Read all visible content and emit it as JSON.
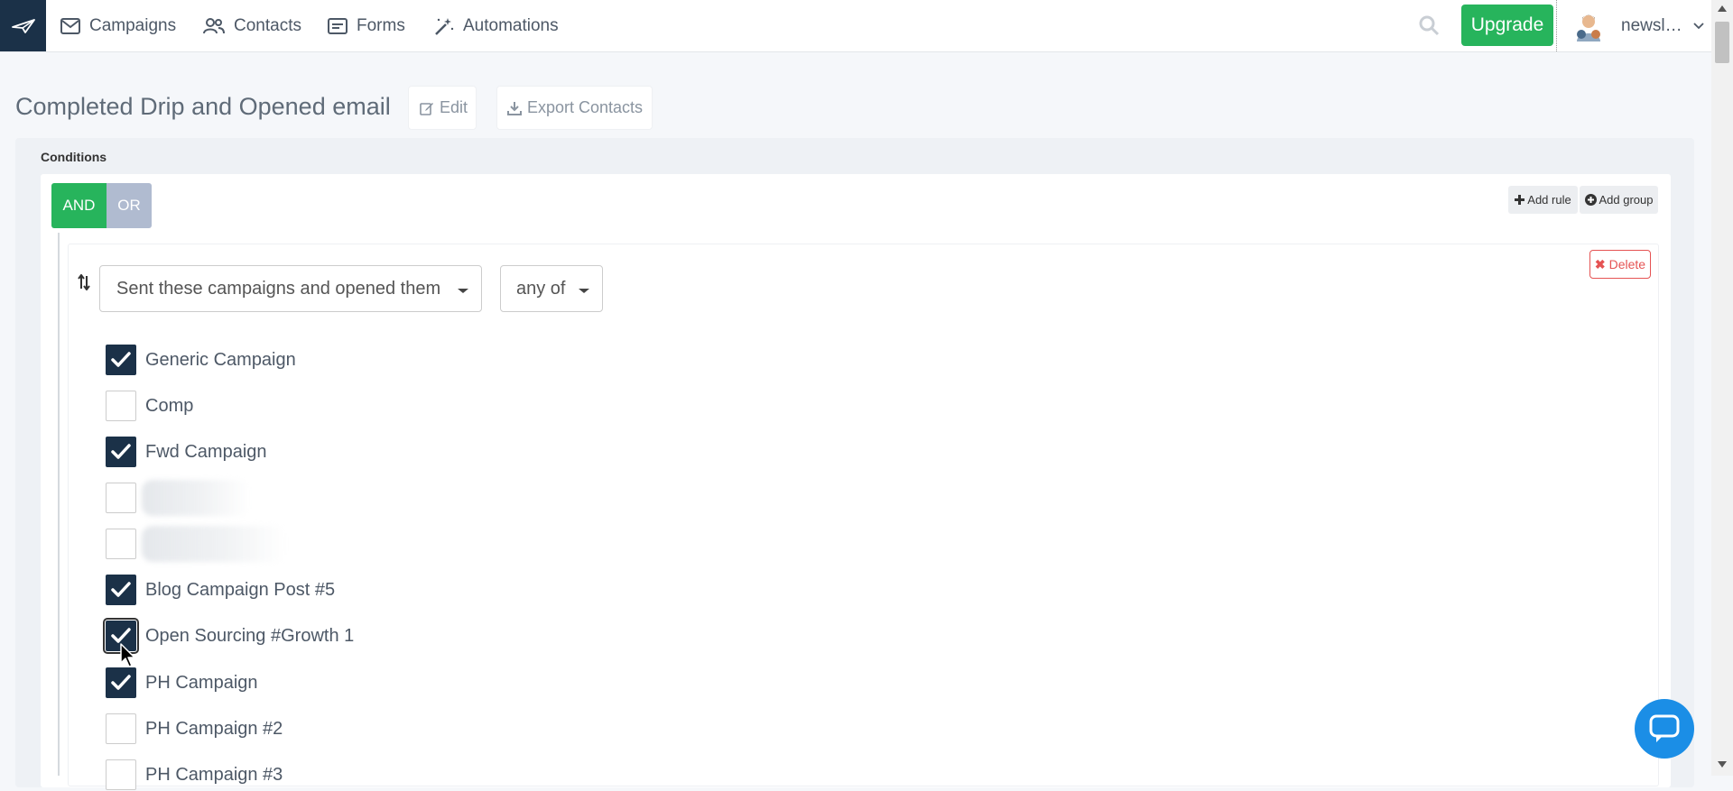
{
  "nav": {
    "campaigns": "Campaigns",
    "contacts": "Contacts",
    "forms": "Forms",
    "automations": "Automations",
    "upgrade": "Upgrade",
    "account": "newsl…"
  },
  "page": {
    "title": "Completed Drip and Opened email",
    "edit": "Edit",
    "export": "Export Contacts"
  },
  "conditions": {
    "label": "Conditions",
    "and": "AND",
    "or": "OR",
    "add_rule": "Add rule",
    "add_group": "Add group",
    "rule": {
      "field": "Sent these campaigns and opened them",
      "operator": "any of",
      "delete": "Delete"
    },
    "campaigns": [
      {
        "label": "Generic Campaign",
        "checked": true
      },
      {
        "label": "Comp",
        "checked": false
      },
      {
        "label": "Fwd Campaign",
        "checked": true
      },
      {
        "label": "",
        "checked": false,
        "redacted": true
      },
      {
        "label": "",
        "checked": false,
        "redacted": true
      },
      {
        "label": "Blog Campaign Post #5",
        "checked": true
      },
      {
        "label": "Open Sourcing #Growth 1",
        "checked": true,
        "focused": true
      },
      {
        "label": "PH Campaign",
        "checked": true
      },
      {
        "label": "PH Campaign #2",
        "checked": false
      },
      {
        "label": "PH Campaign #3",
        "checked": false
      }
    ]
  },
  "colors": {
    "navy": "#1b3148",
    "green": "#27b45c",
    "or_gray": "#b0bbd0",
    "danger": "#e55353",
    "chat_blue": "#1b8ee6"
  }
}
